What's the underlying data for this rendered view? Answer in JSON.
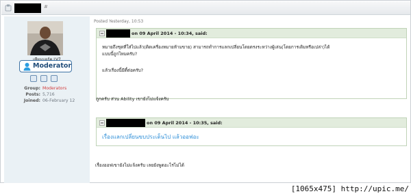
{
  "header": {
    "link_glyph": "#"
  },
  "author": {
    "name": "เซียนบอร์ด LV7",
    "group_badge": "Moderator",
    "stats": [
      {
        "label": "Group:",
        "value": "Moderators"
      },
      {
        "label": "Posts:",
        "value": "5,716"
      },
      {
        "label": "Joined:",
        "value": "06-February 12"
      }
    ]
  },
  "post": {
    "posted": "Posted Yesterday, 10:53",
    "quote1": {
      "date": "on 09 April 2014 - 10:34, said:",
      "lines": [
        "หมายถึงชุดที่ใส่ไปแล้ว(ติดเครื่องหมายห้ามขาย) สามารถทำการแลกเปลี่ยนโดยตรงระหว่างผู้เล่น(โดยการเติมหรือเปล่า)ได้",
        "แบบนี้ถูกไหมครับ?",
        "แล้วเรื่องนี้มีดี้ต่อครับ?"
      ]
    },
    "reply1": "ถูกครับ ส่วน Ability เขายังไม่แจ้งครับ",
    "quote2": {
      "date": "on 09 April 2014 - 10:35, said:",
      "text": "เรื่องแลกเปลี่ยนขบประเด็นไป แล้วออฟอะ"
    },
    "reply2": "เรื่องออฟเขายังไม่แจ้งครับ เลยยังพูดอะไรไม่ได้"
  },
  "caption": "[1065x475] http://upic.me/",
  "colors": {
    "author_bg": "#eaf1f5",
    "quote_head_bg": "#e2ecdd",
    "quote_border": "#bfd3b7",
    "badge_text": "#1f4b78",
    "link_blue": "#2f8fd8",
    "group_red": "#d23b3b"
  }
}
